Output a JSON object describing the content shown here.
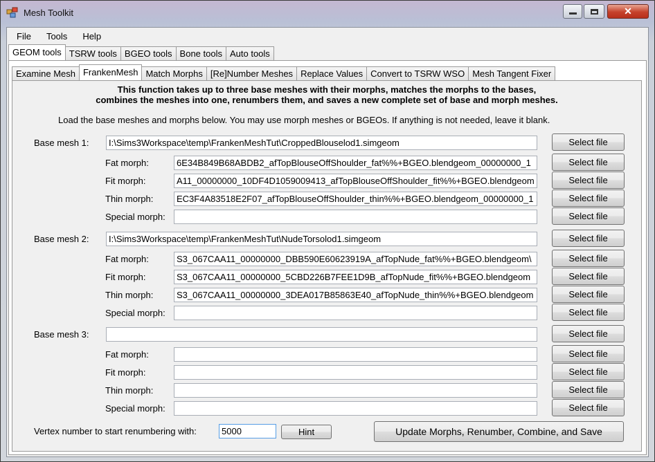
{
  "window": {
    "title": "Mesh Toolkit",
    "controls": {
      "minimize": "▭",
      "maximize": "□",
      "close": "✕"
    }
  },
  "menubar": [
    "File",
    "Tools",
    "Help"
  ],
  "main_tabs": [
    "GEOM tools",
    "TSRW tools",
    "BGEO tools",
    "Bone tools",
    "Auto tools"
  ],
  "main_tab_active": "GEOM tools",
  "sub_tabs": [
    "Examine Mesh",
    "FrankenMesh",
    "Match Morphs",
    "[Re]Number Meshes",
    "Replace Values",
    "Convert to TSRW WSO",
    "Mesh Tangent Fixer"
  ],
  "sub_tab_active": "FrankenMesh",
  "intro_line1": "This function takes up to three base meshes with their morphs, matches the morphs to the bases,",
  "intro_line2": "combines the meshes into one, renumbers them, and saves a new complete set of base and morph meshes.",
  "load_text": "Load the base meshes and morphs below. You may use morph meshes or BGEOs. If anything is not needed, leave it blank.",
  "select_label": "Select file",
  "groups": [
    {
      "base_label": "Base mesh 1:",
      "base_value": "I:\\Sims3Workspace\\temp\\FrankenMeshTut\\CroppedBlouselod1.simgeom",
      "morphs": [
        {
          "label": "Fat morph:",
          "value": "1_00000000_6E34B849B68ABDB2_afTopBlouseOffShoulder_fat%%+BGEO.blendgeom"
        },
        {
          "label": "Fit morph:",
          "value": "A11_00000000_10DF4D1059009413_afTopBlouseOffShoulder_fit%%+BGEO.blendgeom"
        },
        {
          "label": "Thin morph:",
          "value": "1_00000000_EC3F4A83518E2F07_afTopBlouseOffShoulder_thin%%+BGEO.blendgeom"
        },
        {
          "label": "Special morph:",
          "value": ""
        }
      ]
    },
    {
      "base_label": "Base mesh 2:",
      "base_value": "I:\\Sims3Workspace\\temp\\FrankenMeshTut\\NudeTorsolod1.simgeom",
      "morphs": [
        {
          "label": "Fat morph:",
          "value": "\\S3_067CAA11_00000000_DBB590E60623919A_afTopNude_fat%%+BGEO.blendgeom"
        },
        {
          "label": "Fit morph:",
          "value": "S3_067CAA11_00000000_5CBD226B7FEE1D9B_afTopNude_fit%%+BGEO.blendgeom"
        },
        {
          "label": "Thin morph:",
          "value": "S3_067CAA11_00000000_3DEA017B85863E40_afTopNude_thin%%+BGEO.blendgeom"
        },
        {
          "label": "Special morph:",
          "value": ""
        }
      ]
    },
    {
      "base_label": "Base mesh 3:",
      "base_value": "",
      "morphs": [
        {
          "label": "Fat morph:",
          "value": ""
        },
        {
          "label": "Fit morph:",
          "value": ""
        },
        {
          "label": "Thin morph:",
          "value": ""
        },
        {
          "label": "Special morph:",
          "value": ""
        }
      ]
    }
  ],
  "vertex_label": "Vertex number to start renumbering with:",
  "vertex_value": "5000",
  "hint_label": "Hint",
  "update_label": "Update Morphs, Renumber, Combine, and Save"
}
